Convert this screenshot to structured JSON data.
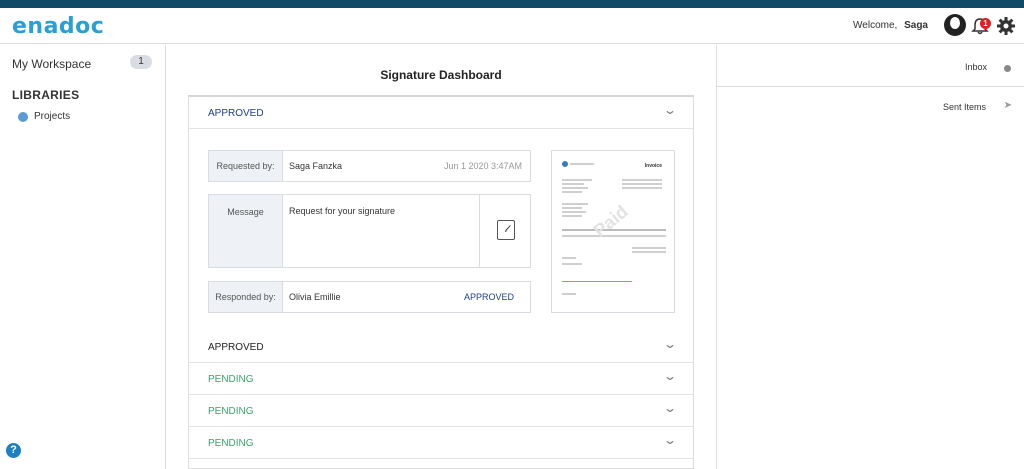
{
  "header": {
    "logo": "enadoc",
    "welcome_label": "Welcome,",
    "user_name": "Saga",
    "notification_count": "1",
    "icons": [
      "user-avatar-icon",
      "bell-icon",
      "gear-icon"
    ]
  },
  "sidebar": {
    "workspace_label": "My Workspace",
    "workspace_count": "1",
    "libraries_heading": "LIBRARIES",
    "items": [
      {
        "label": "Projects",
        "icon": "folder-dot-icon",
        "color": "#5b9bd5"
      }
    ],
    "help_label": "?"
  },
  "main": {
    "title": "Signature Dashboard",
    "requests": [
      {
        "status": "APPROVED",
        "expanded": true
      },
      {
        "status": "APPROVED",
        "expanded": false
      },
      {
        "status": "PENDING",
        "expanded": false
      },
      {
        "status": "PENDING",
        "expanded": false
      },
      {
        "status": "PENDING",
        "expanded": false
      }
    ],
    "detail": {
      "requested_by_label": "Requested by:",
      "requested_by": "Saga Fanzka",
      "requested_time": "Jun 1 2020 3:47AM",
      "message_label": "Message",
      "message": "Request for your signature",
      "responded_by_label": "Responded by:",
      "responded_by": "Olivia Emillie",
      "response_status": "APPROVED",
      "thumbnail_watermark": "Paid",
      "thumbnail_title": "Invoice"
    }
  },
  "right_panel": {
    "inbox_label": "Inbox",
    "sent_label": "Sent Items"
  },
  "colors": {
    "brand": "#2a9fd6",
    "top_strip": "#0f4a66",
    "approved": "#1f3d8f",
    "pending": "#3aa36b"
  }
}
